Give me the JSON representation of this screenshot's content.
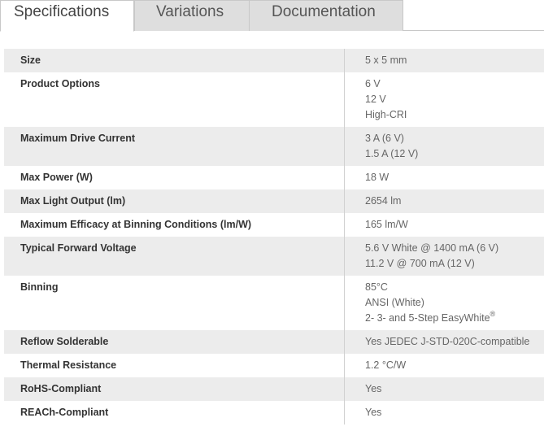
{
  "tabs": [
    {
      "label": "Specifications",
      "active": true
    },
    {
      "label": "Variations",
      "active": false
    },
    {
      "label": "Documentation",
      "active": false
    }
  ],
  "specs": [
    {
      "label": "Size",
      "values": [
        "5 x 5 mm"
      ]
    },
    {
      "label": "Product Options",
      "values": [
        "6 V",
        "12 V",
        "High-CRI"
      ]
    },
    {
      "label": "Maximum Drive Current",
      "values": [
        "3 A (6 V)",
        "1.5 A (12 V)"
      ]
    },
    {
      "label": "Max Power (W)",
      "values": [
        "18 W"
      ]
    },
    {
      "label": "Max Light Output (lm)",
      "values": [
        "2654 lm"
      ]
    },
    {
      "label": "Maximum Efficacy at Binning Conditions (lm/W)",
      "values": [
        "165 lm/W"
      ]
    },
    {
      "label": "Typical Forward Voltage",
      "values": [
        "5.6 V White @ 1400 mA (6 V)",
        "11.2 V @ 700 mA (12 V)"
      ]
    },
    {
      "label": "Binning",
      "values": [
        "85°C",
        "ANSI (White)",
        "2- 3- and 5-Step EasyWhite"
      ],
      "value_sup": "®"
    },
    {
      "label": "Reflow Solderable",
      "values": [
        "Yes JEDEC J-STD-020C-compatible"
      ]
    },
    {
      "label": "Thermal Resistance",
      "values": [
        "1.2 °C/W"
      ]
    },
    {
      "label": "RoHS-Compliant",
      "values": [
        "Yes"
      ]
    },
    {
      "label": "REACh-Compliant",
      "values": [
        "Yes"
      ]
    }
  ]
}
